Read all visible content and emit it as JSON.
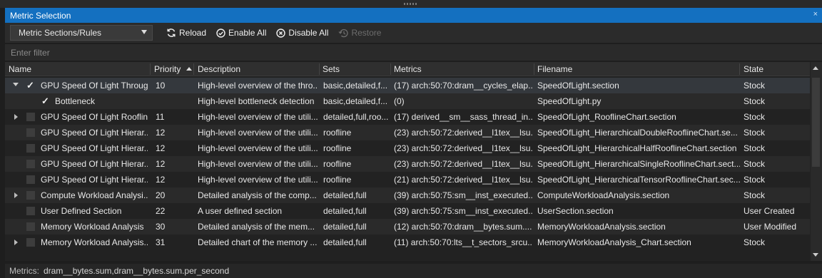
{
  "window": {
    "title": "Metric Selection",
    "close": "×"
  },
  "toolbar": {
    "combo": "Metric Sections/Rules",
    "reload": "Reload",
    "enable_all": "Enable All",
    "disable_all": "Disable All",
    "restore": "Restore"
  },
  "filter": {
    "placeholder": "Enter filter"
  },
  "columns": {
    "name": "Name",
    "priority": "Priority",
    "description": "Description",
    "sets": "Sets",
    "metrics": "Metrics",
    "filename": "Filename",
    "state": "State"
  },
  "rows": [
    {
      "name": "GPU Speed Of Light Throug...",
      "priority": "10",
      "description": "High-level overview of the thro...",
      "sets": "basic,detailed,f...",
      "metrics": "(17) arch:50:70:dram__cycles_elap...",
      "filename": "SpeedOfLight.section",
      "state": "Stock"
    },
    {
      "name": "Bottleneck",
      "priority": "",
      "description": "High-level bottleneck detection",
      "sets": "basic,detailed,f...",
      "metrics": "(0)",
      "filename": "SpeedOfLight.py",
      "state": "Stock"
    },
    {
      "name": "GPU Speed Of Light Rooflin...",
      "priority": "11",
      "description": "High-level overview of the utili...",
      "sets": "detailed,full,roo...",
      "metrics": "(17) derived__sm__sass_thread_in...",
      "filename": "SpeedOfLight_RooflineChart.section",
      "state": "Stock"
    },
    {
      "name": "GPU Speed Of Light Hierar...",
      "priority": "12",
      "description": "High-level overview of the utili...",
      "sets": "roofline",
      "metrics": "(23) arch:50:72:derived__l1tex__lsu...",
      "filename": "SpeedOfLight_HierarchicalDoubleRooflineChart.se...",
      "state": "Stock"
    },
    {
      "name": "GPU Speed Of Light Hierar...",
      "priority": "12",
      "description": "High-level overview of the utili...",
      "sets": "roofline",
      "metrics": "(23) arch:50:72:derived__l1tex__lsu...",
      "filename": "SpeedOfLight_HierarchicalHalfRooflineChart.section",
      "state": "Stock"
    },
    {
      "name": "GPU Speed Of Light Hierar...",
      "priority": "12",
      "description": "High-level overview of the utili...",
      "sets": "roofline",
      "metrics": "(23) arch:50:72:derived__l1tex__lsu...",
      "filename": "SpeedOfLight_HierarchicalSingleRooflineChart.sect...",
      "state": "Stock"
    },
    {
      "name": "GPU Speed Of Light Hierar...",
      "priority": "12",
      "description": "High-level overview of the utili...",
      "sets": "roofline",
      "metrics": "(21) arch:50:72:derived__l1tex__lsu...",
      "filename": "SpeedOfLight_HierarchicalTensorRooflineChart.sec...",
      "state": "Stock"
    },
    {
      "name": "Compute Workload Analysi...",
      "priority": "20",
      "description": "Detailed analysis of the comp...",
      "sets": "detailed,full",
      "metrics": "(39) arch:50:75:sm__inst_executed...",
      "filename": "ComputeWorkloadAnalysis.section",
      "state": "Stock"
    },
    {
      "name": "User Defined Section",
      "priority": "22",
      "description": "A user defined section",
      "sets": "detailed,full",
      "metrics": "(39) arch:50:75:sm__inst_executed...",
      "filename": "UserSection.section",
      "state": "User Created"
    },
    {
      "name": "Memory Workload Analysis",
      "priority": "30",
      "description": "Detailed analysis of the mem...",
      "sets": "detailed,full",
      "metrics": "(12) arch:50:70:dram__bytes.sum....",
      "filename": "MemoryWorkloadAnalysis.section",
      "state": "User Modified"
    },
    {
      "name": "Memory Workload Analysis...",
      "priority": "31",
      "description": "Detailed chart of the memory ...",
      "sets": "detailed,full",
      "metrics": "(11) arch:50:70:lts__t_sectors_srcu...",
      "filename": "MemoryWorkloadAnalysis_Chart.section",
      "state": "Stock"
    }
  ],
  "status": {
    "label": "Metrics:",
    "value": "dram__bytes.sum,dram__bytes.sum.per_second"
  }
}
